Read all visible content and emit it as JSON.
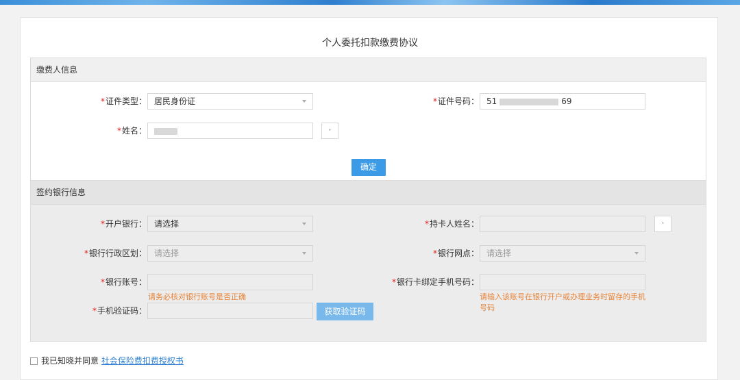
{
  "page_title": "个人委托扣款缴费协议",
  "payer_section": {
    "header": "缴费人信息",
    "id_type": {
      "label": "证件类型：",
      "value": "居民身份证"
    },
    "id_number": {
      "label": "证件号码：",
      "value_prefix": "51",
      "value_suffix": "69"
    },
    "name": {
      "label": "姓名："
    },
    "dot_button": "·",
    "confirm_button": "确定"
  },
  "bank_section": {
    "header": "签约银行信息",
    "open_bank": {
      "label": "开户银行：",
      "value": "请选择"
    },
    "cardholder_name": {
      "label": "持卡人姓名：",
      "value": ""
    },
    "dot_button": "·",
    "bank_region": {
      "label": "银行行政区划：",
      "placeholder": "请选择"
    },
    "bank_branch": {
      "label": "银行网点：",
      "placeholder": "请选择"
    },
    "account_number": {
      "label": "银行账号：",
      "value": "",
      "hint": "请务必核对银行账号是否正确"
    },
    "bound_phone": {
      "label": "银行卡绑定手机号码：",
      "value": "",
      "hint_line1": "请输入该账号在银行开户或办理业务时留存的手机",
      "hint_line2": "号码"
    },
    "sms_code": {
      "label": "手机验证码：",
      "value": ""
    },
    "get_code_button": "获取验证码"
  },
  "agreement": {
    "text": "我已知晓并同意",
    "link": "社会保险费扣费授权书"
  },
  "colors": {
    "primary": "#3c9be6",
    "required": "#e02020",
    "hint": "#e8853a",
    "link": "#2e7fd1"
  }
}
